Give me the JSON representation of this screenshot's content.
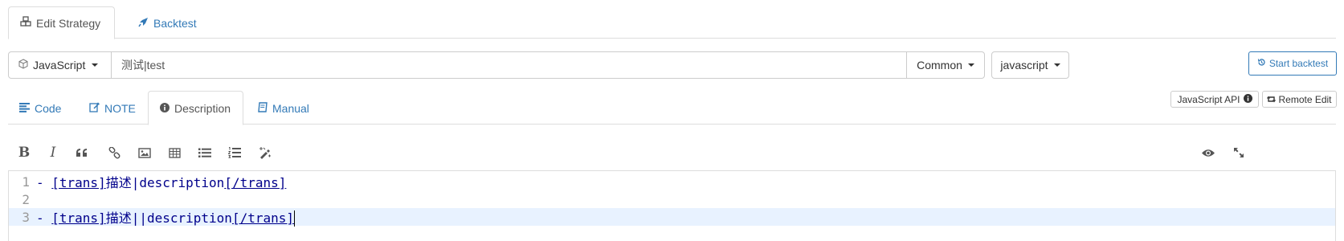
{
  "top_tabs": {
    "edit_strategy": "Edit Strategy",
    "backtest": "Backtest"
  },
  "strategy": {
    "language": "JavaScript",
    "name": "测试|test",
    "category": "Common",
    "version": "javascript"
  },
  "actions": {
    "start_backtest": "Start backtest",
    "js_api": "JavaScript API",
    "remote_edit": "Remote Edit"
  },
  "sub_tabs": {
    "code": "Code",
    "note": "NOTE",
    "description": "Description",
    "manual": "Manual"
  },
  "toolbar_icons": [
    "bold-icon",
    "italic-icon",
    "quote-icon",
    "link-icon",
    "image-icon",
    "table-icon",
    "unordered-list-icon",
    "ordered-list-icon",
    "clean-block-icon",
    "preview-icon",
    "fullscreen-icon"
  ],
  "editor": {
    "lines": [
      {
        "num": "1",
        "prefix": "- ",
        "open_tag": "[trans]",
        "text": "描述|description",
        "close_tag": "[/trans]"
      },
      {
        "num": "2",
        "prefix": "",
        "open_tag": "",
        "text": "",
        "close_tag": ""
      },
      {
        "num": "3",
        "prefix": "- ",
        "open_tag": "[trans]",
        "text": "描述||description",
        "close_tag": "[/trans]"
      }
    ]
  },
  "colors": {
    "link": "#337ab7",
    "border": "#dddddd",
    "editor_text": "#00008b",
    "active_line": "#e8f2ff"
  }
}
